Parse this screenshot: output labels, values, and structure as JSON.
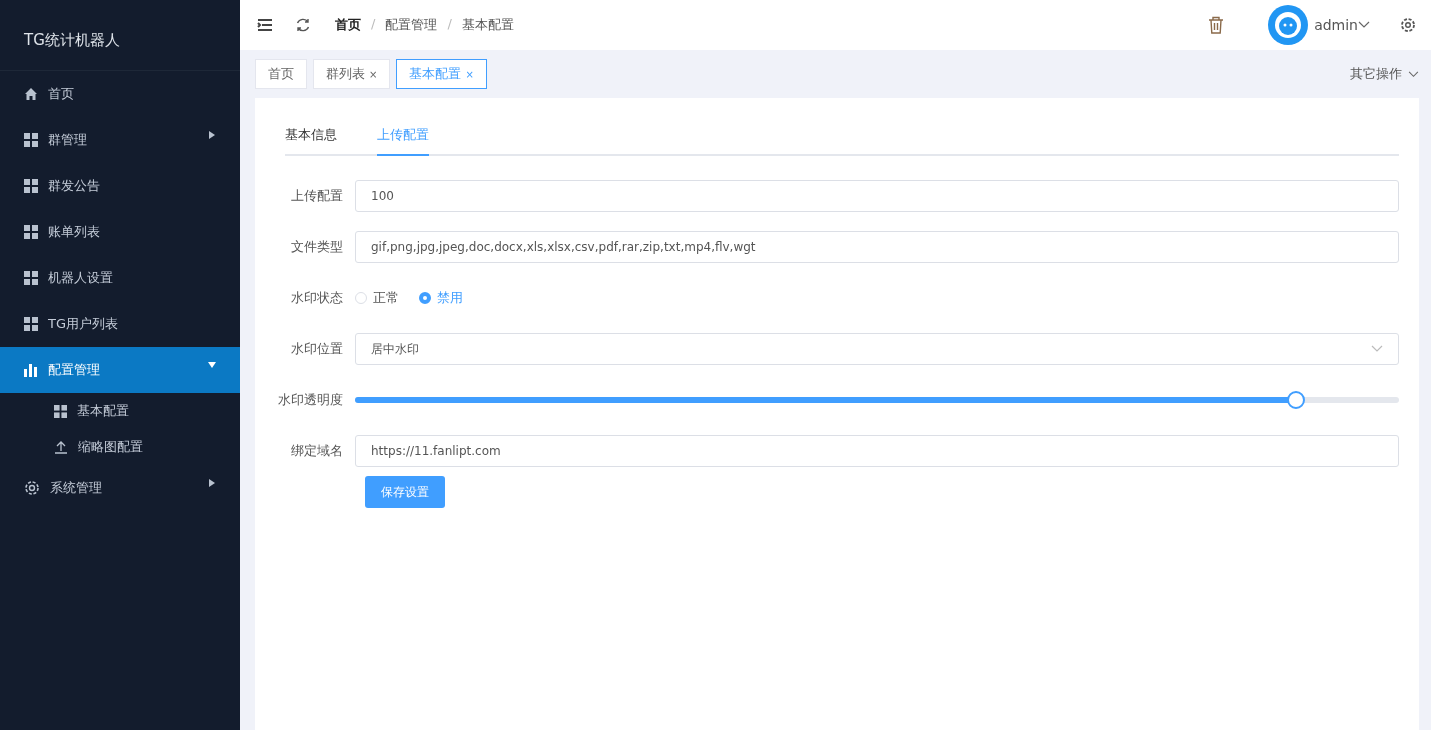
{
  "sidebar": {
    "title": "TG统计机器人",
    "items": [
      {
        "label": "首页",
        "kind": "home",
        "selected": false
      },
      {
        "label": "群管理",
        "kind": "grid",
        "selected": false,
        "expanded": false
      },
      {
        "label": "群发公告",
        "kind": "grid",
        "selected": false
      },
      {
        "label": "账单列表",
        "kind": "grid",
        "selected": false
      },
      {
        "label": "机器人设置",
        "kind": "grid",
        "selected": false
      },
      {
        "label": "TG用户列表",
        "kind": "grid",
        "selected": false
      },
      {
        "label": "配置管理",
        "kind": "chart",
        "selected": true,
        "expanded": true,
        "children": [
          {
            "label": "基本配置",
            "kind": "grid"
          },
          {
            "label": "缩略图配置",
            "kind": "upload"
          }
        ]
      },
      {
        "label": "系统管理",
        "kind": "gear",
        "selected": false,
        "expanded": false
      }
    ]
  },
  "header": {
    "breadcrumb": [
      "首页",
      "配置管理",
      "基本配置"
    ],
    "breadcrumb_separator": "/",
    "user": "admin"
  },
  "tags": [
    {
      "label": "首页",
      "selected": false
    },
    {
      "label": "群列表",
      "selected": false,
      "close": "×"
    },
    {
      "label": "基本配置",
      "selected": true,
      "close": "×"
    }
  ],
  "other_actions": "其它操作",
  "tabs": [
    {
      "label": "基本信息",
      "selected": false
    },
    {
      "label": "上传配置",
      "selected": true
    }
  ],
  "form": [
    {
      "kind": "text",
      "label": "上传配置",
      "value": "100"
    },
    {
      "kind": "text",
      "label": "文件类型",
      "value": "gif,png,jpg,jpeg,doc,docx,xls,xlsx,csv,pdf,rar,zip,txt,mp4,flv,wgt"
    },
    {
      "kind": "radio",
      "label": "水印状态",
      "options": [
        {
          "label": "正常",
          "selected": false
        },
        {
          "label": "禁用",
          "selected": true
        }
      ]
    },
    {
      "kind": "select",
      "label": "水印位置",
      "value": "居中水印"
    },
    {
      "kind": "slider",
      "label": "水印透明度",
      "level": 0.9
    },
    {
      "kind": "text",
      "label": "绑定域名",
      "value": "https://11.fanlipt.com"
    }
  ],
  "save_button": "保存设置"
}
